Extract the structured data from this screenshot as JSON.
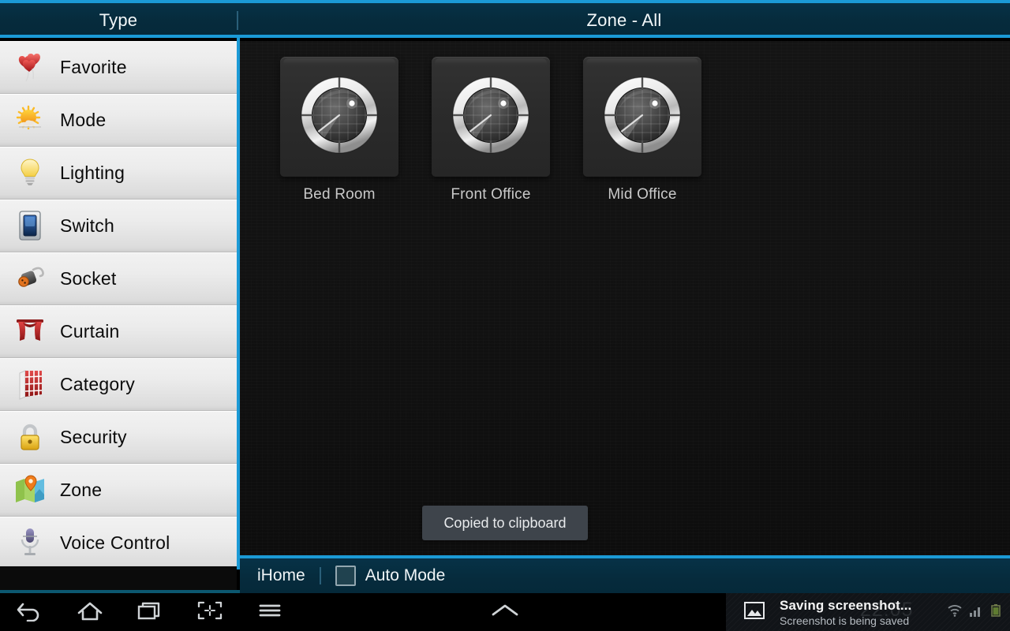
{
  "header": {
    "type_label": "Type",
    "zone_title": "Zone - All"
  },
  "sidebar": {
    "items": [
      {
        "label": "Favorite",
        "icon": "balloons-hearts-icon"
      },
      {
        "label": "Mode",
        "icon": "sun-cloud-icon"
      },
      {
        "label": "Lighting",
        "icon": "lightbulb-icon"
      },
      {
        "label": "Switch",
        "icon": "wall-switch-icon"
      },
      {
        "label": "Socket",
        "icon": "power-plug-icon"
      },
      {
        "label": "Curtain",
        "icon": "curtain-icon"
      },
      {
        "label": "Category",
        "icon": "shelf-grid-icon"
      },
      {
        "label": "Security",
        "icon": "padlock-icon"
      },
      {
        "label": "Zone",
        "icon": "map-pin-icon"
      },
      {
        "label": "Voice Control",
        "icon": "microphone-icon"
      }
    ]
  },
  "main": {
    "tiles": [
      {
        "label": "Bed Room",
        "icon": "radar-dial-icon"
      },
      {
        "label": "Front Office",
        "icon": "radar-dial-icon"
      },
      {
        "label": "Mid Office",
        "icon": "radar-dial-icon"
      }
    ]
  },
  "toast": {
    "message": "Copied to clipboard"
  },
  "footer": {
    "app_name": "iHome",
    "auto_mode_label": "Auto Mode",
    "auto_mode_checked": false
  },
  "navbar": {
    "buttons": [
      {
        "name": "back",
        "icon": "back-arrow-icon"
      },
      {
        "name": "home",
        "icon": "home-icon"
      },
      {
        "name": "recents",
        "icon": "recents-icon"
      },
      {
        "name": "screenshot",
        "icon": "screenshot-icon"
      },
      {
        "name": "menu",
        "icon": "hamburger-menu-icon"
      }
    ],
    "expand_icon": "chevron-up-icon"
  },
  "notification": {
    "title": "Saving screenshot...",
    "subtitle": "Screenshot is being saved",
    "icon": "image-picture-icon",
    "clock": "22:05",
    "status_icons": [
      "wifi-icon",
      "signal-bars-icon",
      "battery-icon"
    ]
  },
  "colors": {
    "accent_blue": "#1b9ad6",
    "header_teal": "#062b3c",
    "panel_dark": "#111111",
    "sidebar_light": "#ececec",
    "toast_grey": "#3e444b"
  }
}
